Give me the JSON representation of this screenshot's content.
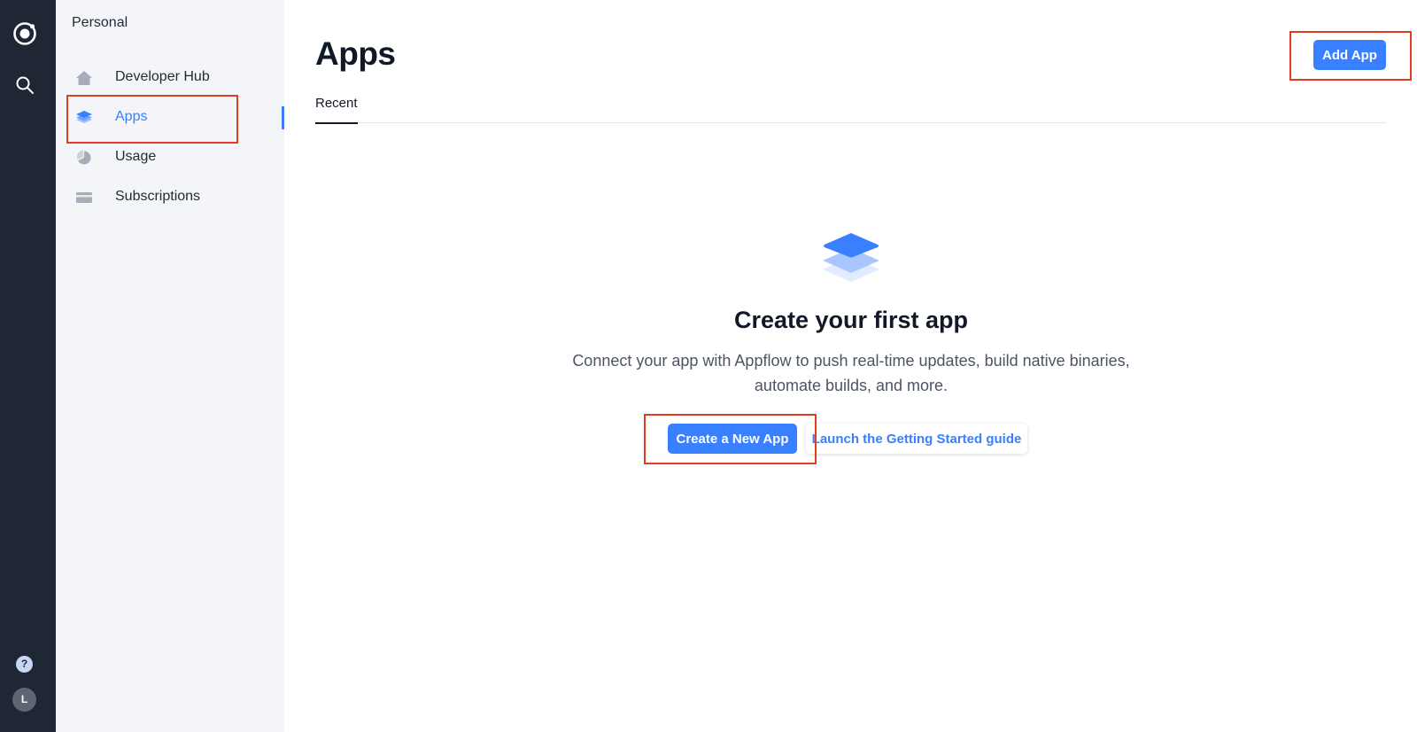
{
  "colors": {
    "rail_bg": "#1e2733",
    "sidebar_bg": "#f4f5f8",
    "accent": "#3880ff",
    "highlight": "#e53a24"
  },
  "rail": {
    "logo_icon": "ionic-logo-icon",
    "search_icon": "search-icon",
    "help_label": "?",
    "avatar_label": "L"
  },
  "sidebar": {
    "org": "Personal",
    "items": [
      {
        "label": "Developer Hub",
        "icon": "home-icon"
      },
      {
        "label": "Apps",
        "icon": "layers-icon",
        "active": true
      },
      {
        "label": "Usage",
        "icon": "pie-chart-icon"
      },
      {
        "label": "Subscriptions",
        "icon": "credit-card-icon"
      }
    ]
  },
  "main": {
    "title": "Apps",
    "add_button": "Add App",
    "tabs": [
      {
        "label": "Recent"
      }
    ],
    "empty_state": {
      "icon": "layers-icon",
      "heading": "Create your first app",
      "description": "Connect your app with Appflow to push real-time updates, build native binaries, automate builds, and more.",
      "primary_button": "Create a New App",
      "secondary_button": "Launch the Getting Started guide"
    }
  }
}
